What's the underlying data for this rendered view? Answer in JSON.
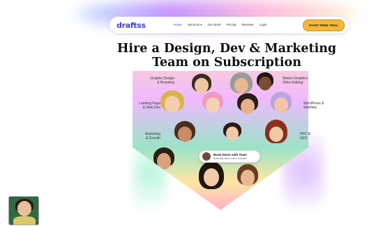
{
  "brand": {
    "logo": "draftss",
    "color": "#3b3fd8"
  },
  "nav": {
    "links": [
      "Home",
      "Services ▾",
      "Our Work",
      "Pricing",
      "Reviews",
      "Login"
    ],
    "cta": "START FREE TRIAL"
  },
  "hero": {
    "title_line1": "Hire a Design, Dev & Marketing",
    "title_line2": "Team on Subscription"
  },
  "services": {
    "left": [
      {
        "line1": "Graphic Design",
        "line2": "& Branding"
      },
      {
        "line1": "Landing Page",
        "line2": "& Web Dev"
      },
      {
        "line1": "Marketing",
        "line2": "& Growth"
      }
    ],
    "right": [
      {
        "line1": "Motion Graphics",
        "line2": "Video Editing"
      },
      {
        "line1": "WordPress &",
        "line2": "Webflow"
      },
      {
        "line1": "PPC &",
        "line2": "SEO"
      }
    ]
  },
  "book_call": {
    "title": "Book Demo with Team",
    "subtitle": "Schedule demo call in minutes"
  },
  "video": {
    "label": ""
  },
  "colors": {
    "accent": "#3b3fd8",
    "cta": "#f5b73a"
  }
}
